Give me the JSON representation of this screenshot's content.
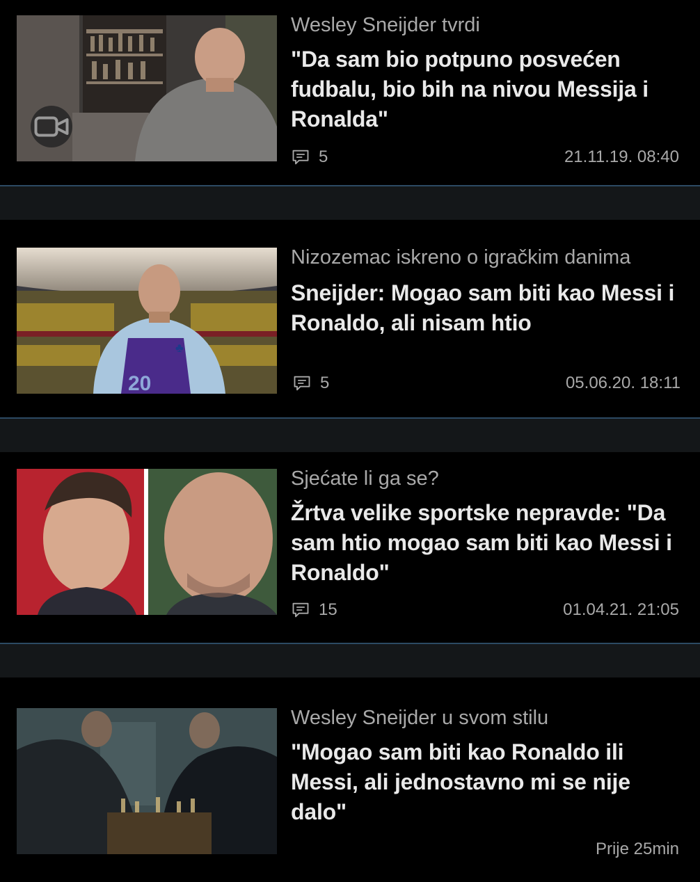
{
  "articles": [
    {
      "kicker": "Wesley Sneijder tvrdi",
      "headline": "\"Da sam bio potpuno posvećen fudbalu, bio bih na nivou Messija i Ronalda\"",
      "comments": "5",
      "date": "21.11.19. 08:40",
      "has_video": true,
      "thumb_icon": "video-camera-icon"
    },
    {
      "kicker": "Nizozemac iskreno o igračkim danima",
      "headline": "Sneijder: Mogao sam biti kao Messi i Ronaldo, ali nisam htio",
      "comments": "5",
      "date": "05.06.20. 18:11"
    },
    {
      "kicker": "Sjećate li ga se?",
      "headline": "Žrtva velike sportske nepravde: \"Da sam htio mogao sam biti kao Messi i Ronaldo\"",
      "comments": "15",
      "date": "01.04.21. 21:05"
    },
    {
      "kicker": "Wesley Sneijder u svom stilu",
      "headline": "\"Mogao sam biti kao Ronaldo ili Messi, ali jednostavno mi se nije dalo\"",
      "date": "Prije 25min"
    }
  ],
  "colors": {
    "background": "#000000",
    "divider": "#141719",
    "divider_line": "#2c4a63",
    "kicker": "#a9a9a9",
    "headline": "#e9e9e9"
  },
  "icons": {
    "comment": "comment-bubble-icon"
  }
}
